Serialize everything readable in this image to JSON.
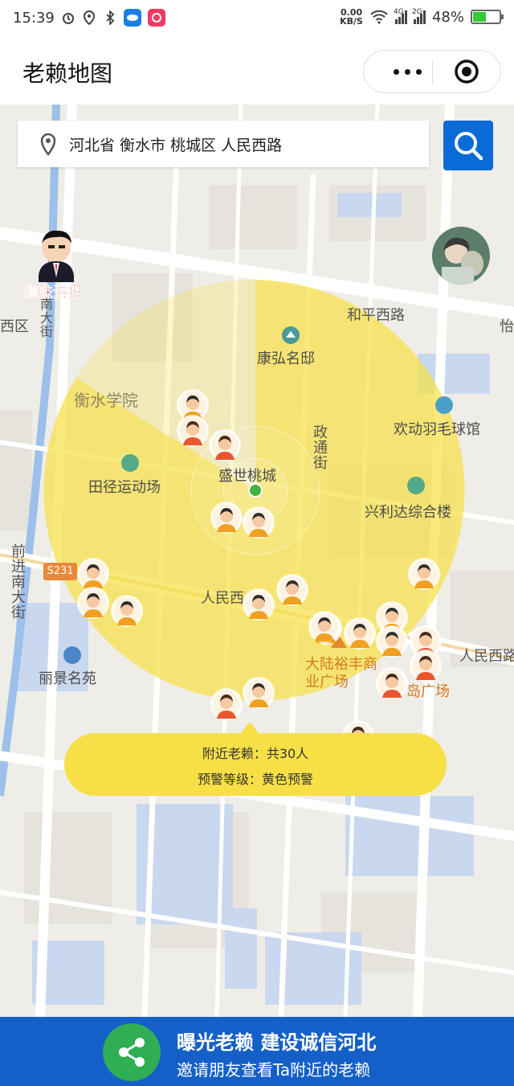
{
  "status_bar": {
    "time": "15:39",
    "net_speed_top": "0.00",
    "net_speed_bottom": "KB/S",
    "sig1": "4G",
    "sig2": "2G",
    "battery": "48%",
    "battery_level": 0.48,
    "icons": [
      "alarm-icon",
      "location-icon",
      "bluetooth-icon",
      "app-eye-icon",
      "app-red-icon",
      "wifi-icon",
      "signal-icon",
      "battery-icon"
    ]
  },
  "nav": {
    "title": "老赖地图",
    "icons": [
      "more-icon",
      "target-icon"
    ]
  },
  "search": {
    "address": "河北省 衡水市 桃城区 人民西路"
  },
  "poster": {
    "label": "趣味海报"
  },
  "map_labels": {
    "hepingxilu": "和平西路",
    "kanghong": "康弘名邸",
    "hengshui_xueyuan": "衡水学院",
    "huandong": "欢动羽毛球馆",
    "zhengtong_jie": "政通街",
    "shengshi": "盛世桃城",
    "tianjing": "田径运动场",
    "xinglida": "兴利达综合楼",
    "qianjin_nan": "前进南大街",
    "renmin_center": "人民西",
    "renmin_right": "人民西路",
    "lijing": "丽景名苑",
    "dalu": "大陆裕丰商业广场",
    "dao_guangchang": "岛广场",
    "route": "S231",
    "xiqu": "西区",
    "nan_dajie_top": "南大街",
    "yi": "怡"
  },
  "info_bubble": {
    "nearby": "附近老赖：共30人",
    "level": "预警等级：黄色预警",
    "nearby_count": 30
  },
  "footer": {
    "line1": "曝光老赖 建设诚信河北",
    "line2": "邀请朋友查看Ta附近的老赖"
  },
  "colors": {
    "accent": "#0a6bd6",
    "footer_bg": "#1460c8",
    "share": "#2fae54",
    "warning_zone": "#f7e046",
    "poster_red": "#e01f2c"
  }
}
